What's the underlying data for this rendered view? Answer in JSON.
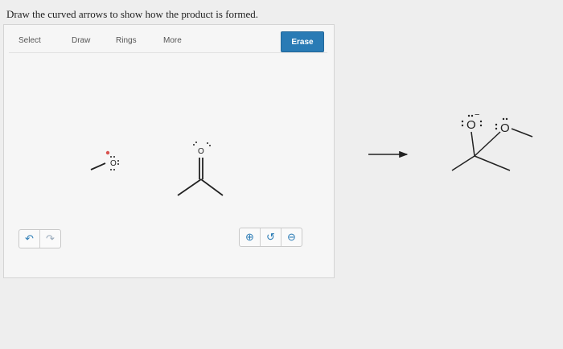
{
  "question": "Draw the curved arrows to show how the product is formed.",
  "toolbar": {
    "select_label": "Select",
    "draw_label": "Draw",
    "rings_label": "Rings",
    "more_label": "More",
    "erase_label": "Erase"
  },
  "history_buttons": {
    "undo_icon": "↶",
    "redo_icon": "↷"
  },
  "zoom_buttons": {
    "zoom_in_icon": "⊕",
    "reset_icon": "↺",
    "zoom_out_icon": "⊖"
  },
  "molecules": {
    "methoxide_atom": "O",
    "acetone_atom": "O",
    "product_atom_1": "O",
    "product_atom_2": "O",
    "product_charge": "−"
  },
  "colors": {
    "accent": "#2a7bb5",
    "charge_red": "#d9534f",
    "bond": "#222222"
  }
}
